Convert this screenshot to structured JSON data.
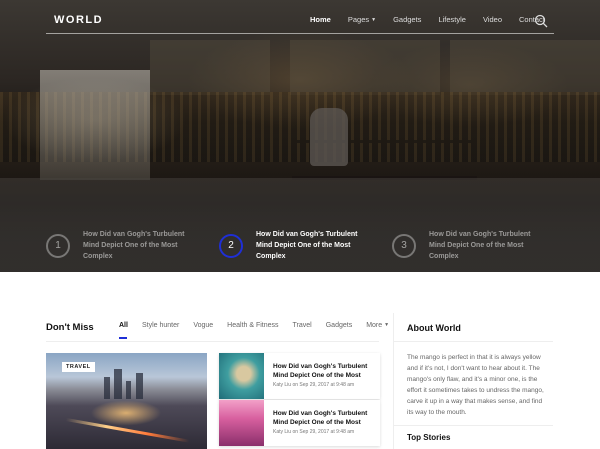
{
  "brand": "WORLD",
  "nav": {
    "items": [
      {
        "label": "Home",
        "active": true
      },
      {
        "label": "Pages",
        "active": false,
        "dropdown": true
      },
      {
        "label": "Gadgets",
        "active": false
      },
      {
        "label": "Lifestyle",
        "active": false
      },
      {
        "label": "Video",
        "active": false
      },
      {
        "label": "Contact",
        "active": false
      }
    ],
    "search_icon": "search-icon"
  },
  "hero": {
    "slides": [
      {
        "number": "1",
        "title": "How Did van Gogh's Turbulent Mind Depict One of the Most Complex"
      },
      {
        "number": "2",
        "title": "How Did van Gogh's Turbulent Mind Depict One of the Most Complex"
      },
      {
        "number": "3",
        "title": "How Did van Gogh's Turbulent Mind Depict One of the Most Complex"
      }
    ],
    "active_slide": 2,
    "active_color": "#1f2fd6"
  },
  "dont_miss": {
    "title": "Don't Miss",
    "tabs": [
      "All",
      "Style hunter",
      "Vogue",
      "Health & Fitness",
      "Travel",
      "Gadgets",
      "More"
    ],
    "active_tab": "All",
    "feature_badge": "TRAVEL",
    "posts": [
      {
        "title": "How Did van Gogh's Turbulent Mind Depict One of the Most",
        "author": "Katy Liu",
        "date_prefix": "on",
        "date": "Sep 29, 2017 at 9:48 am"
      },
      {
        "title": "How Did van Gogh's Turbulent Mind Depict One of the Most",
        "author": "Katy Liu",
        "date_prefix": "on",
        "date": "Sep 29, 2017 at 9:48 am"
      }
    ]
  },
  "sidebar": {
    "about_title": "About World",
    "about_text": "The mango is perfect in that it is always yellow and if it's not, I don't want to hear about it. The mango's only flaw, and it's a minor one, is the effort it sometimes takes to undress the mango, carve it up in a way that makes sense, and find its way to the mouth.",
    "top_stories_title": "Top Stories"
  }
}
